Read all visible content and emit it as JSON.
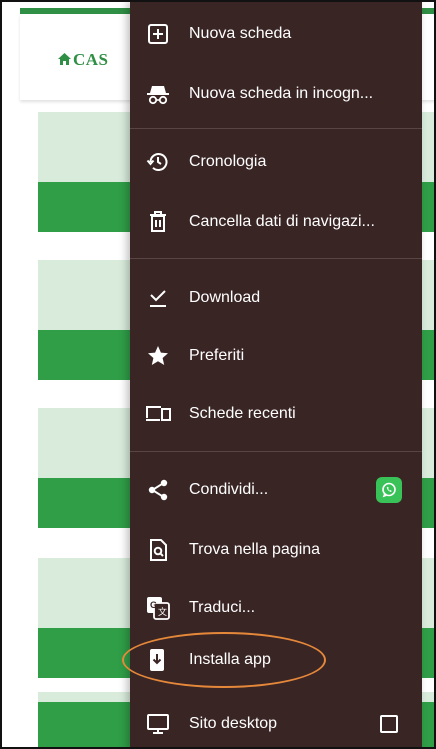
{
  "page": {
    "logo_text": "CAS",
    "accent_color": "#2f8f44"
  },
  "menu": {
    "items": [
      {
        "label": "Nuova scheda",
        "icon": "new-tab-icon"
      },
      {
        "label": "Nuova scheda in incogn...",
        "icon": "incognito-icon"
      },
      {
        "label": "Cronologia",
        "icon": "history-icon"
      },
      {
        "label": "Cancella dati di navigazi...",
        "icon": "trash-icon"
      },
      {
        "label": "Download",
        "icon": "download-icon"
      },
      {
        "label": "Preferiti",
        "icon": "star-icon"
      },
      {
        "label": "Schede recenti",
        "icon": "recent-tabs-icon"
      },
      {
        "label": "Condividi...",
        "icon": "share-icon",
        "trailing_icon": "whatsapp-icon"
      },
      {
        "label": "Trova nella pagina",
        "icon": "find-in-page-icon"
      },
      {
        "label": "Traduci...",
        "icon": "translate-icon"
      },
      {
        "label": "Installa app",
        "icon": "install-app-icon",
        "highlighted": true
      },
      {
        "label": "Sito desktop",
        "icon": "desktop-icon",
        "trailing_icon": "checkbox-icon",
        "checked": false
      }
    ],
    "background_color": "#3a2525",
    "highlight_color": "#e5883a"
  }
}
